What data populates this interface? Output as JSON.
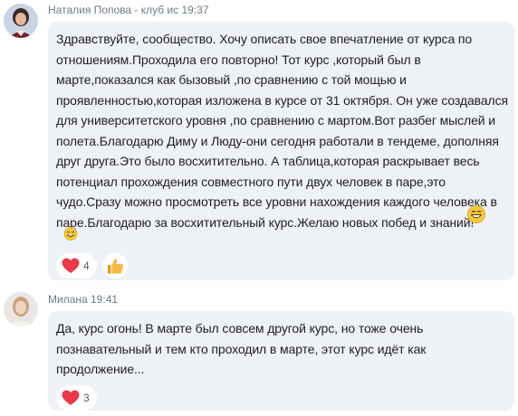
{
  "messages": [
    {
      "sender": "Наталия Попова - клуб ис 19:37",
      "avatar_icon": "user-avatar-photo",
      "lines": [
        "Здравствуйте, сообщество. Хочу описать свое впечатление от курса по",
        "отношениям.Проходила его повторно! Тот курс ,который был в",
        "марте,показался как  бызовый ,по сравнению с той мощью и",
        "проявленностью,которая изложена в  курсе от 31 октября. Он уже создавался",
        "для университетского уровня ,по сравнению с мартом.Вот разбег мыслей и",
        "полета.Благодарю Диму и Люду-они сегодня работали в тендеме, дополняя",
        "друг друга.Это было восхитительно. А таблица,которая раскрывает весь",
        "потенциал прохождения совместного пути двух человек в паре,это",
        "чудо.Сразу можно просмотреть все уровни нахождения каждого человека в",
        "паре.Благодарю за восхитительный курс.Желаю новых побед и знаний!"
      ],
      "emojis": [
        "grinning-face-emoji",
        "sweat-smile-emoji"
      ],
      "reactions": [
        {
          "icon": "heart-icon",
          "count": "4"
        },
        {
          "icon": "thumbs-up-icon",
          "count": ""
        }
      ]
    },
    {
      "sender": "Милана 19:41",
      "avatar_icon": "user-avatar-photo",
      "lines": [
        "Да, курс огонь! В марте был совсем другой курс,  но тоже очень",
        "познавательный и тем кто проходил в марте, этот курс  идёт как",
        "продолжение..."
      ],
      "emojis": [],
      "reactions": [
        {
          "icon": "heart-icon",
          "count": "3"
        }
      ]
    }
  ],
  "colors": {
    "bubble": "#eef1f6",
    "heart": "#e8394a",
    "thumb": "#f5b942",
    "sender_text": "#6f7b86"
  }
}
